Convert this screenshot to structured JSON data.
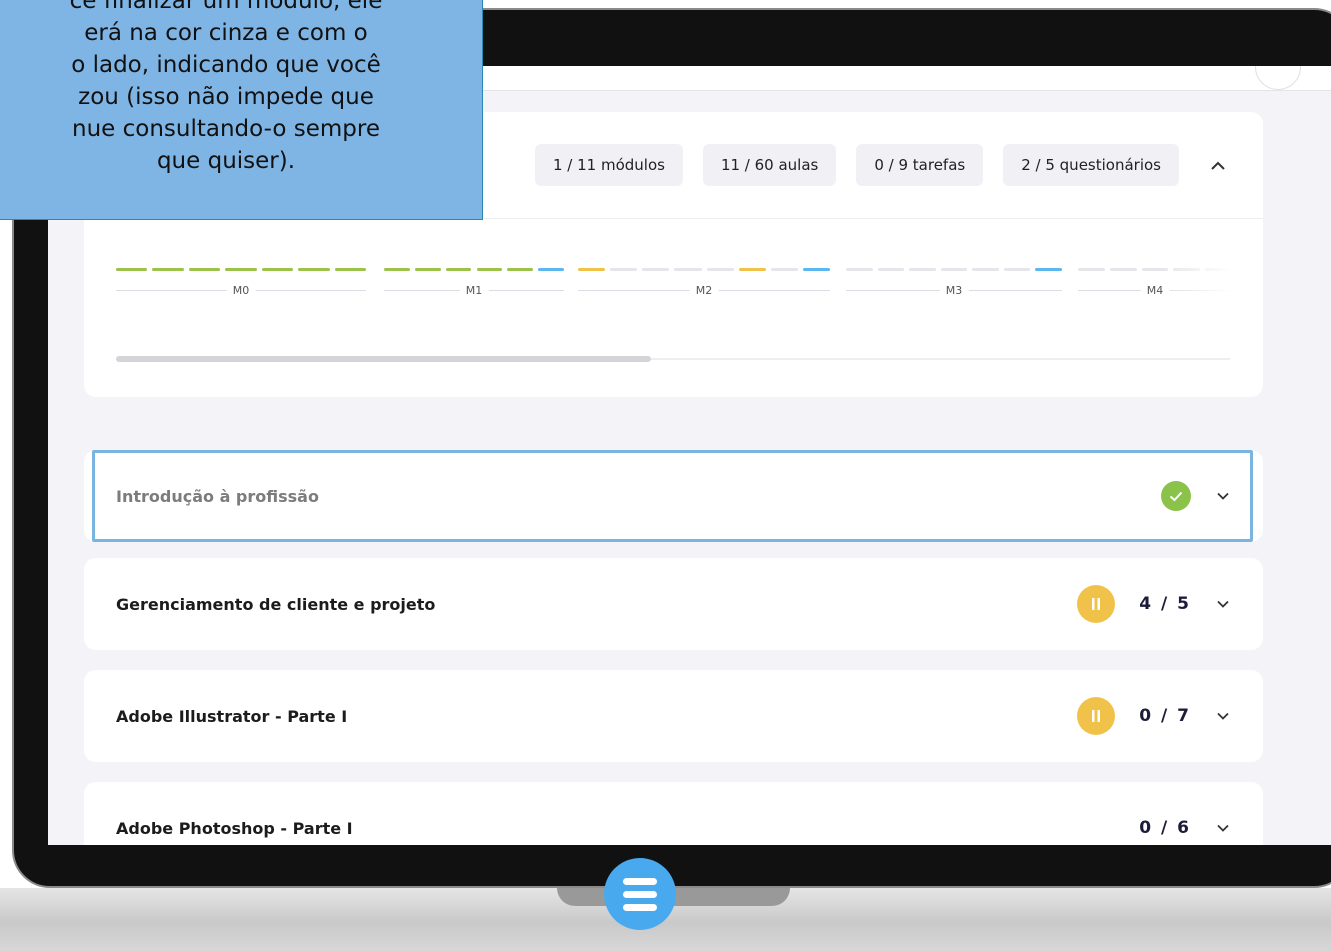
{
  "tooltip": {
    "lines": [
      "cê finalizar um módulo, ele",
      "erá na cor cinza e com o",
      "o lado, indicando que você",
      "zou (isso não impede que",
      "nue consultando-o sempre",
      "que quiser)."
    ]
  },
  "progress": {
    "modules_stat": "1 / 11 módulos",
    "lessons_stat": "11 / 60 aulas",
    "tasks_stat": "0 / 9 tarefas",
    "quizzes_stat": "2 / 5 questionários",
    "collapse_icon": "chevron-up-icon",
    "module_labels": [
      "M0",
      "M1",
      "M2",
      "M3",
      "M4"
    ],
    "scroll_fraction": 0.48,
    "colors": {
      "completed": "#9bc24a",
      "in_progress": "#f0c24a",
      "current": "#5bb7ee",
      "pending": "#e6e6ea"
    }
  },
  "modules": [
    {
      "title": "Introdução à profissão",
      "status": "completed",
      "count": "",
      "icon": "check-icon",
      "highlighted": true
    },
    {
      "title": "Gerenciamento de cliente e projeto",
      "status": "in-progress",
      "count": "4 / 5",
      "icon": "pause-icon",
      "highlighted": false
    },
    {
      "title": "Adobe Illustrator - Parte I",
      "status": "in-progress",
      "count": "0 / 7",
      "icon": "pause-icon",
      "highlighted": false
    },
    {
      "title": "Adobe Photoshop - Parte I",
      "status": "not-started",
      "count": "0 / 6",
      "icon": "",
      "highlighted": false
    }
  ],
  "colors": {
    "accent": "#49a9ee",
    "highlight_border": "#7ab4e0",
    "tooltip_bg": "#7fb5e4",
    "done_green": "#8bc34a",
    "pause_yellow": "#f0c24a"
  }
}
